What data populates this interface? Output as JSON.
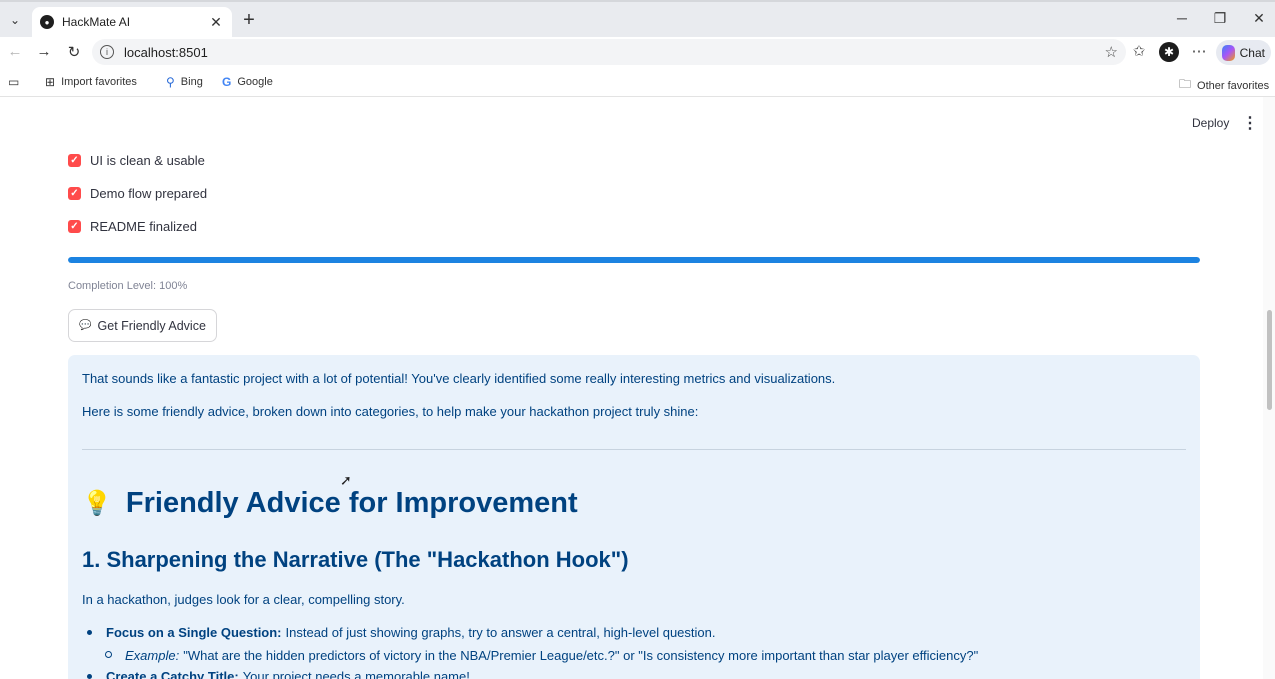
{
  "browser": {
    "tab_title": "HackMate AI",
    "url": "localhost:8501",
    "chat_label": "Chat",
    "favorites": [
      {
        "label": "Import favorites",
        "icon": "import-icon"
      },
      {
        "label": "Bing",
        "icon": "search-icon"
      },
      {
        "label": "Google",
        "icon": "google-icon"
      }
    ],
    "other_favorites": "Other favorites"
  },
  "header": {
    "deploy_label": "Deploy"
  },
  "checklist": [
    {
      "label": "UI is clean & usable",
      "checked": true
    },
    {
      "label": "Demo flow prepared",
      "checked": true
    },
    {
      "label": "README finalized",
      "checked": true
    }
  ],
  "progress": {
    "value_percent": 100,
    "label": "Completion Level: 100%",
    "color": "#1c83e1"
  },
  "advice_button": {
    "label": "Get Friendly Advice"
  },
  "advice": {
    "intro": "That sounds like a fantastic project with a lot of potential! You've clearly identified some really interesting metrics and visualizations.",
    "lead": "Here is some friendly advice, broken down into categories, to help make your hackathon project truly shine:",
    "heading": "Friendly Advice for Improvement",
    "section1_title": "1. Sharpening the Narrative (The \"Hackathon Hook\")",
    "section1_intro": "In a hackathon, judges look for a clear, compelling story.",
    "bullet1_bold": "Focus on a Single Question:",
    "bullet1_text": "Instead of just showing graphs, try to answer a central, high-level question.",
    "sub1_italic": "Example:",
    "sub1_text": "\"What are the hidden predictors of victory in the NBA/Premier League/etc.?\" or \"Is consistency more important than star player efficiency?\"",
    "bullet2_bold": "Create a Catchy Title:",
    "bullet2_text": "Your project needs a memorable name!"
  },
  "colors": {
    "accent": "#ff4b4b",
    "info_bg": "#e9f2fb",
    "info_text": "#004280"
  }
}
